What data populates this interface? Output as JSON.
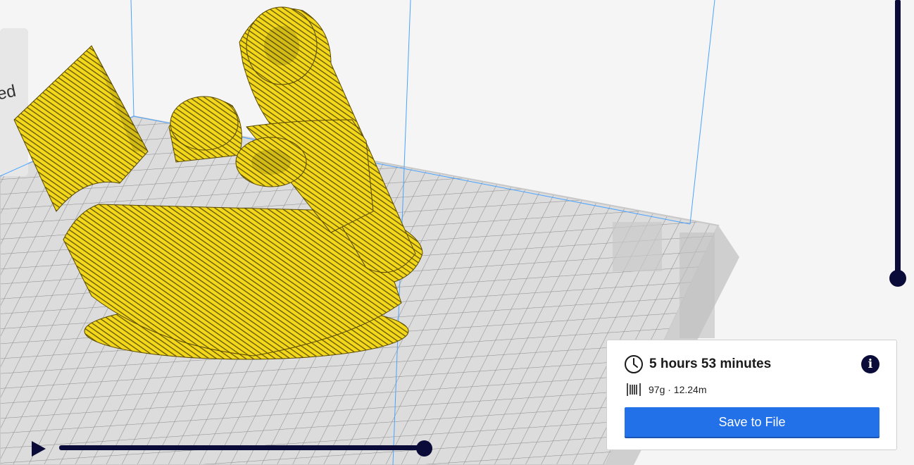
{
  "viewport": {
    "machine_label_fragment": "ed"
  },
  "output": {
    "print_time": "5 hours 53 minutes",
    "material": "97g · 12.24m",
    "save_label": "Save to File",
    "info_glyph": "i"
  },
  "icons": {
    "clock": "clock-icon",
    "spool": "filament-spool-icon",
    "info": "info-icon",
    "play": "play-icon"
  },
  "colors": {
    "model_yellow": "#f2d71b",
    "slider_navy": "#0b0b3a",
    "button_blue": "#2271e8",
    "build_volume_lines": "#4aa3ff"
  }
}
